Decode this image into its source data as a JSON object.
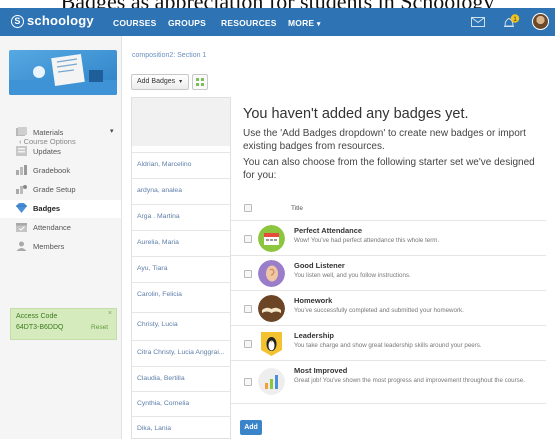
{
  "caption": "Badges as appreciation for students in Schoology",
  "topnav": {
    "logo": "schoology",
    "logo_mark": "S",
    "items": [
      "COURSES",
      "GROUPS",
      "RESOURCES",
      "MORE"
    ],
    "more_caret": "▾",
    "notification_count": "1",
    "colors": {
      "bar": "#2e73b4",
      "badge": "#f0c419"
    }
  },
  "sidebar": {
    "course_options": "Course Options",
    "items": [
      {
        "label": "Materials",
        "icon": "materials-icon",
        "has_caret": true
      },
      {
        "label": "Updates",
        "icon": "updates-icon"
      },
      {
        "label": "Gradebook",
        "icon": "gradebook-icon"
      },
      {
        "label": "Grade Setup",
        "icon": "grade-setup-icon"
      },
      {
        "label": "Badges",
        "icon": "badge-icon",
        "active": true
      },
      {
        "label": "Attendance",
        "icon": "attendance-icon"
      },
      {
        "label": "Members",
        "icon": "members-icon"
      }
    ],
    "materials_caret": "▾",
    "access_code": {
      "title": "Access Code",
      "code": "64DT3-B6DDQ",
      "reset": "Reset",
      "close": "×"
    }
  },
  "breadcrumb": "composition2: Section 1",
  "toolbar": {
    "add_badges": "Add Badges",
    "caret": "▾",
    "grid_icon": "grid-icon"
  },
  "students": [
    "Aldrian, Marcelino",
    "ardyna, analea",
    "Arga . Martina",
    "Aurelia, Maria",
    "Ayu, Tiara",
    "Carolin, Felicia",
    "Christy, Lucia",
    "Citra Christy, Lucia Anggrai...",
    "Claudia, Bertilla",
    "Cynthia, Cornelia",
    "Dika, Lania"
  ],
  "panel": {
    "headline": "You haven't added any badges yet.",
    "desc1": "Use the 'Add Badges dropdown' to create new badges or import existing badges from resources.",
    "desc2": "You can also choose from the following starter set we've designed for you:",
    "title_header": "Title",
    "badges": [
      {
        "name": "Perfect Attendance",
        "desc": "Wow! You've had perfect attendance this whole term.",
        "icon": "calendar-badge-icon"
      },
      {
        "name": "Good Listener",
        "desc": "You listen well, and you follow instructions.",
        "icon": "ear-badge-icon"
      },
      {
        "name": "Homework",
        "desc": "You've successfully completed and submitted your homework.",
        "icon": "book-badge-icon"
      },
      {
        "name": "Leadership",
        "desc": "You take charge and show great leadership skills around your peers.",
        "icon": "penguin-badge-icon"
      },
      {
        "name": "Most Improved",
        "desc": "Great job! You've shown the most progress and improvement throughout the course.",
        "icon": "chart-badge-icon"
      }
    ],
    "add_button": "Add"
  }
}
